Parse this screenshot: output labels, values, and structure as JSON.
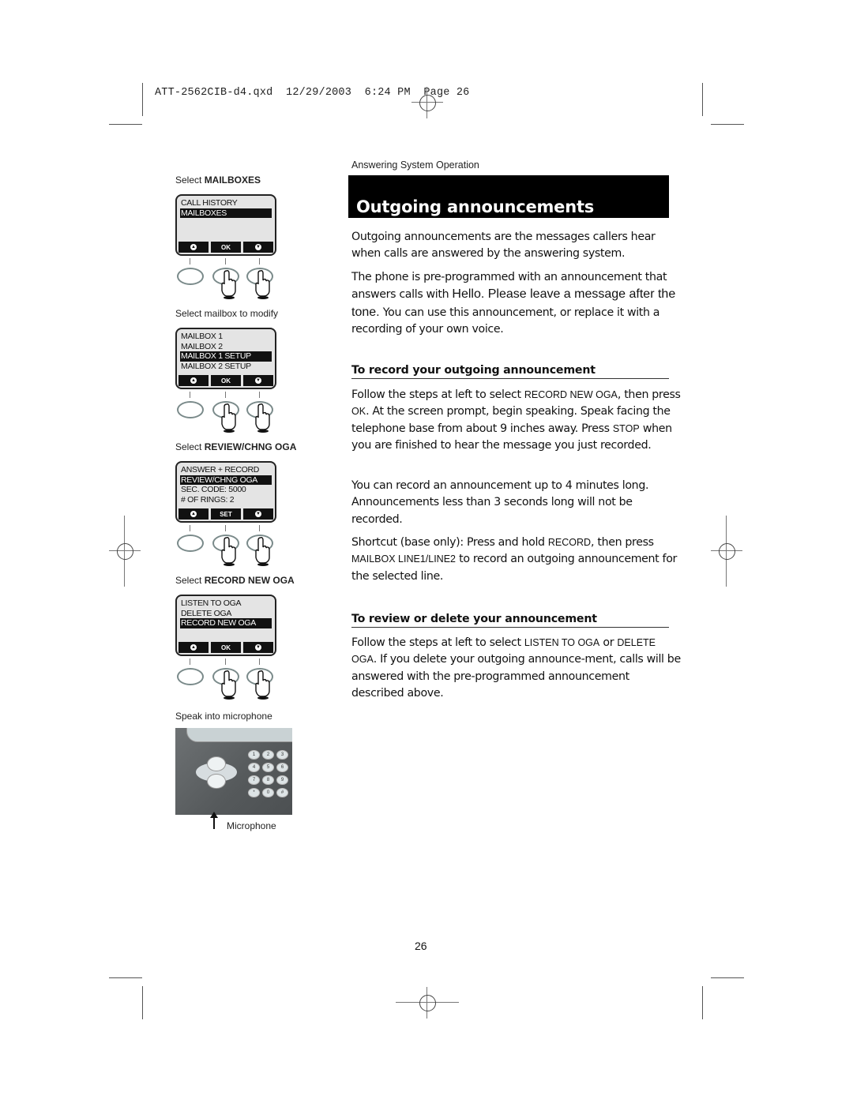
{
  "print_slug": "ATT-2562CIB-d4.qxd  12/29/2003  6:24 PM  Page 26",
  "section_name": "Answering System Operation",
  "title": "Outgoing announcements",
  "intro": "Outgoing announcements are the messages callers hear when calls are answered by the answering system.",
  "preprogrammed": {
    "before": "The phone is pre-programmed with an announcement that answers calls with ",
    "quote": "Hello. Please leave a message after the tone.",
    "after": " You can use this announcement, or replace it with a recording of your own voice."
  },
  "record_section": {
    "heading": "To record your outgoing announcement",
    "p1": {
      "a": "Follow the steps at left to select ",
      "k1": "RECORD NEW OGA",
      "b": ", then press ",
      "k2": "OK",
      "c": ". At the screen prompt, begin speaking. Speak facing the telephone base from about 9 inches away. Press ",
      "k3": "STOP",
      "d": " when you are finished to hear the message you just recorded."
    },
    "p2": "You can record an announcement up to 4 minutes long. Announcements less than 3 seconds long will not be recorded.",
    "p3": {
      "a": "Shortcut (base only): Press and hold ",
      "k1": "RECORD",
      "b": ", then press ",
      "k2": "MAILBOX LINE1/LINE2",
      "c": " to record an outgoing announcement for the selected line."
    }
  },
  "review_section": {
    "heading": "To review or delete your announcement",
    "p1": {
      "a": "Follow the steps at left to select ",
      "k1": "LISTEN TO OGA",
      "b": " or ",
      "k2": "DELETE OGA",
      "c": ". If you delete your outgoing announce-ment, calls will be answered with the pre-programmed announcement described above."
    }
  },
  "steps": [
    {
      "label_plain": "Select ",
      "label_bold": "MAILBOXES",
      "lines": [
        {
          "text": "CALL HISTORY",
          "selected": false
        },
        {
          "text": "MAILBOXES",
          "selected": true
        }
      ],
      "softkeys": [
        "up-icon",
        "OK",
        "down-icon"
      ]
    },
    {
      "label_plain": "Select mailbox to modify",
      "label_bold": "",
      "lines": [
        {
          "text": "MAILBOX 1",
          "selected": false
        },
        {
          "text": "MAILBOX 2",
          "selected": false
        },
        {
          "text": "MAILBOX 1 SETUP",
          "selected": true
        },
        {
          "text": "MAILBOX 2 SETUP",
          "selected": false
        }
      ],
      "softkeys": [
        "up-icon",
        "OK",
        "down-icon"
      ]
    },
    {
      "label_plain": "Select ",
      "label_bold": "REVIEW/CHNG OGA",
      "lines": [
        {
          "text": "ANSWER + RECORD",
          "selected": false
        },
        {
          "text": "REVIEW/CHNG OGA",
          "selected": true
        },
        {
          "text": "SEC. CODE: 5000",
          "selected": false
        },
        {
          "text": "# OF RINGS: 2",
          "selected": false
        }
      ],
      "softkeys": [
        "up-icon",
        "SET",
        "down-icon"
      ]
    },
    {
      "label_plain": "Select ",
      "label_bold": "RECORD NEW OGA",
      "lines": [
        {
          "text": "LISTEN TO OGA",
          "selected": false
        },
        {
          "text": "DELETE OGA",
          "selected": false
        },
        {
          "text": "RECORD NEW OGA",
          "selected": true
        }
      ],
      "softkeys": [
        "up-icon",
        "OK",
        "down-icon"
      ]
    }
  ],
  "speak_label": "Speak into microphone",
  "microphone_label": "Microphone",
  "keypad": [
    "1",
    "2",
    "3",
    "4",
    "5",
    "6",
    "7",
    "8",
    "9",
    "*",
    "0",
    "#"
  ],
  "page_number": "26"
}
